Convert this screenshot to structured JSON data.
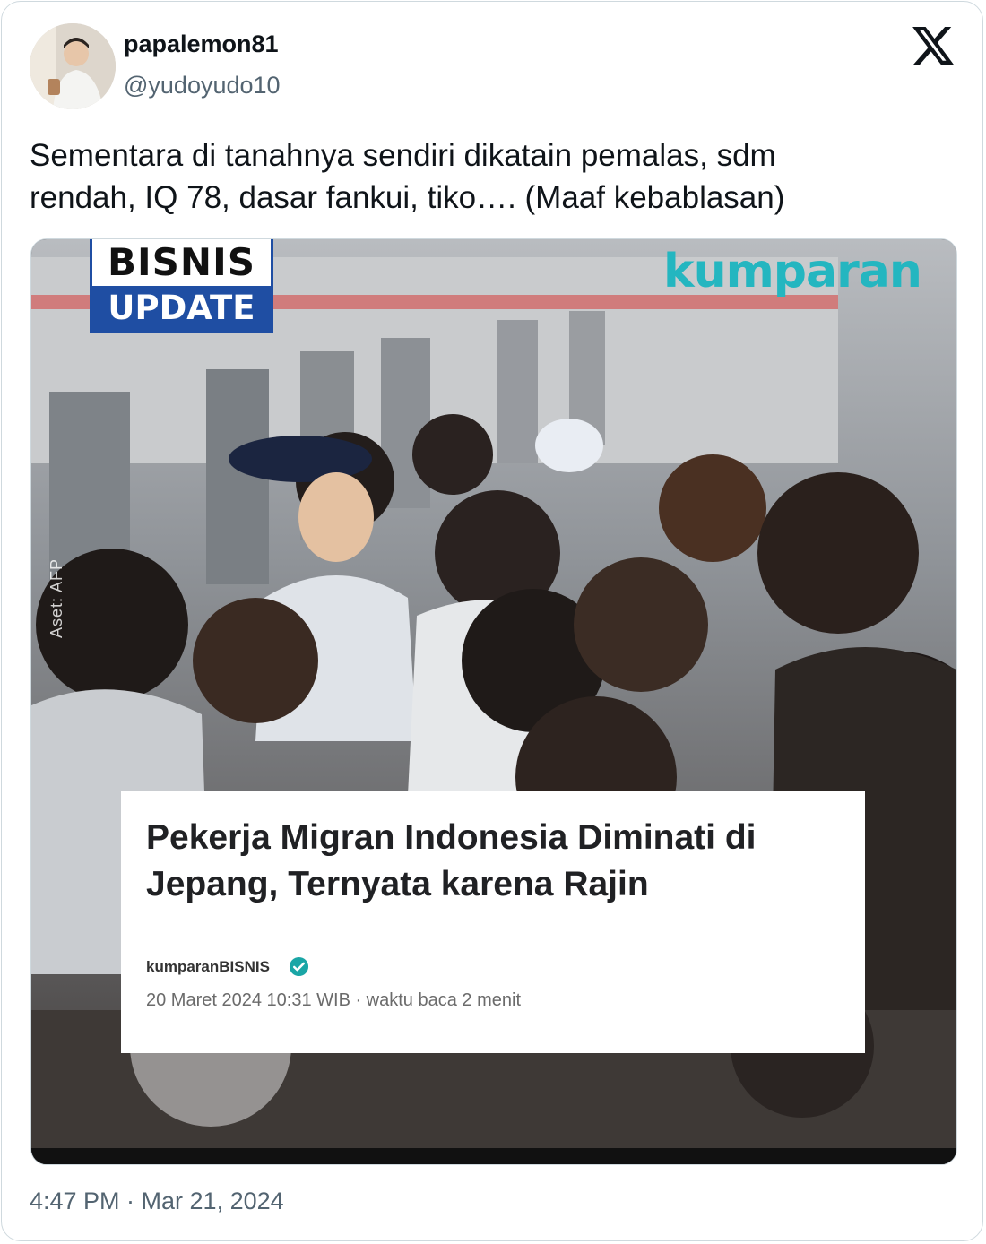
{
  "tweet": {
    "display_name": "papalemon81",
    "handle": "@yudoyudo10",
    "text": "Sementara di tanahnya sendiri dikatain pemalas, sdm\nrendah, IQ 78, dasar fankui, tiko…. (Maaf kebablasan)",
    "timestamp": "4:47 PM · Mar 21, 2024",
    "platform_icon": "x-logo-icon"
  },
  "media": {
    "badge_top": "BISNIS",
    "badge_bottom": "UPDATE",
    "brand": "kumparan",
    "brand_color": "#24b6c0",
    "credit": "Aset: AFP",
    "headline": "Pekerja Migran Indonesia Diminati di Jepang, Ternyata karena Rajin",
    "author": "kumparanBISNIS",
    "meta": "20 Maret 2024 10:31 WIB · waktu baca 2 menit",
    "verified_color": "#1aa6a6"
  }
}
